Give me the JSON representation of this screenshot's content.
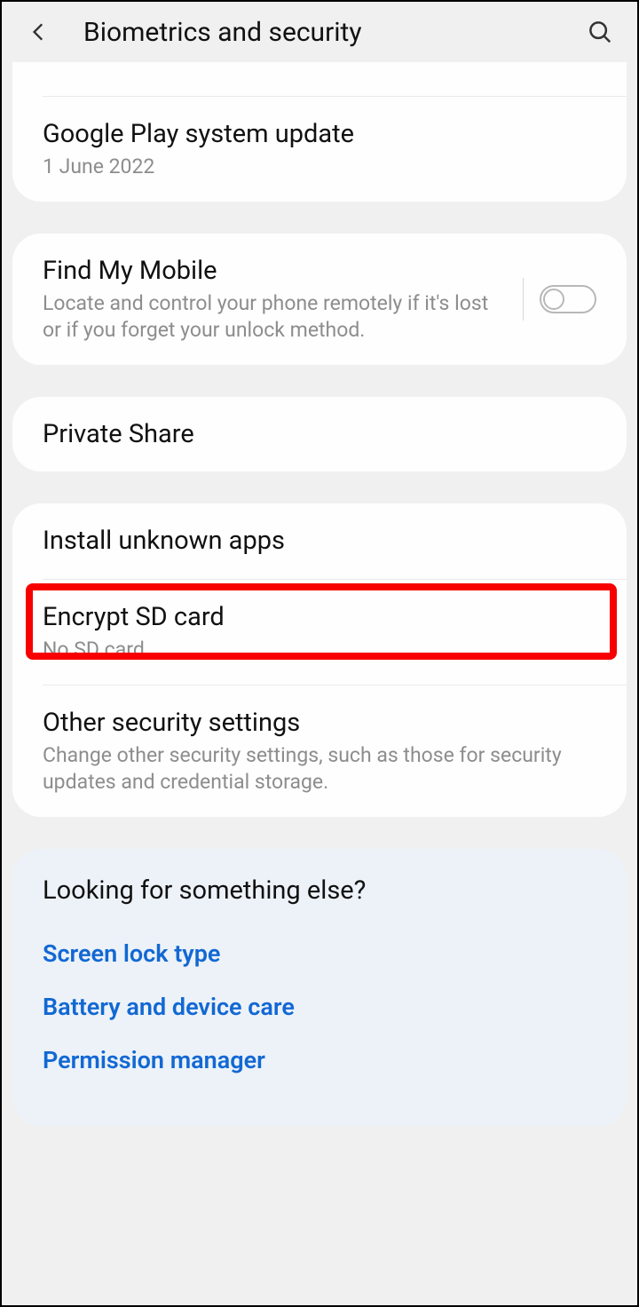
{
  "header": {
    "title": "Biometrics and security"
  },
  "peek_date": "1 June 2022",
  "items": {
    "google_play": {
      "title": "Google Play system update",
      "sub": "1 June 2022"
    },
    "find_mobile": {
      "title": "Find My Mobile",
      "sub": "Locate and control your phone remotely if it's lost or if you forget your unlock method."
    },
    "private_share": {
      "title": "Private Share"
    },
    "install_unknown": {
      "title": "Install unknown apps"
    },
    "encrypt_sd": {
      "title": "Encrypt SD card",
      "sub": "No SD card"
    },
    "other_security": {
      "title": "Other security settings",
      "sub": "Change other security settings, such as those for security updates and credential storage."
    }
  },
  "looking_heading": "Looking for something else?",
  "links": {
    "screen_lock": "Screen lock type",
    "battery": "Battery and device care",
    "permission": "Permission manager"
  }
}
